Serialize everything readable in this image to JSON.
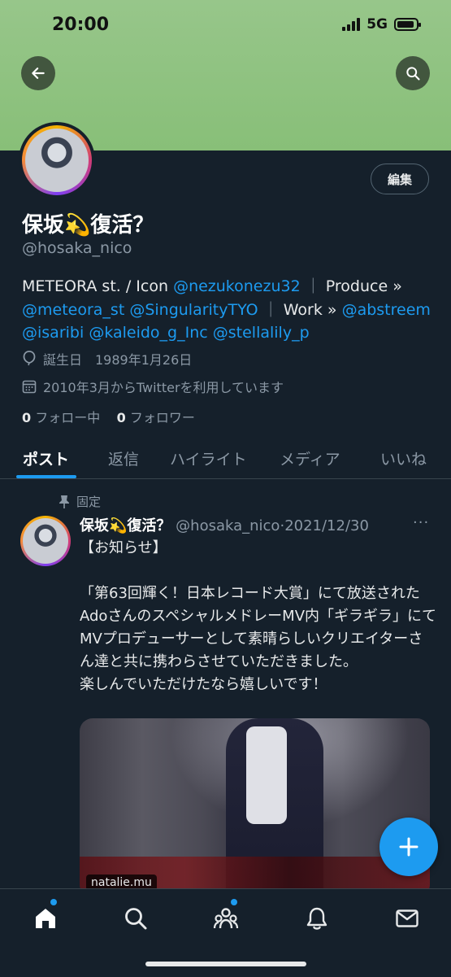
{
  "status": {
    "time": "20:00",
    "network": "5G"
  },
  "profile": {
    "display_name": "保坂💫復活？",
    "handle": "@hosaka_nico",
    "edit_label": "編集",
    "bio": {
      "part1": "METEORA st. / Icon ",
      "mention1": "@nezukonezu32",
      "sep1": " ｜ ",
      "part2": "Produce » ",
      "mention2": "@meteora_st",
      "mention3": "@SingularityTYO",
      "sep2": " ｜ ",
      "part3": "Work » ",
      "mention4": "@abstreem",
      "mention5": "@isaribi",
      "mention6": "@kaleido_g_Inc",
      "mention7": "@stellalily_p"
    },
    "birthday": "誕生日　1989年1月26日",
    "joined": "2010年3月からTwitterを利用しています",
    "following_count": "0",
    "following_label": "フォロー中",
    "followers_count": "0",
    "followers_label": "フォロワー"
  },
  "tabs": [
    "ポスト",
    "返信",
    "ハイライト",
    "メディア",
    "いいね"
  ],
  "post": {
    "pinned_label": "固定",
    "name": "保坂💫復活？",
    "handle": "@hosaka_nico",
    "date": "2021/12/30",
    "more": "···",
    "text": "【お知らせ】\n\n「第63回輝く！日本レコード大賞」にて放送されたAdoさんのスペシャルメドレーMV内「ギラギラ」にてMVプロデューサーとして素晴らしいクリエイターさん達と共に携わらさせていただきました。\n楽しんでいただけたなら嬉しいです！",
    "media_source": "natalie.mu"
  },
  "icons": {
    "back": "arrow-left-icon",
    "search": "search-icon",
    "birthday": "balloon-icon",
    "calendar": "calendar-icon",
    "pin": "pin-icon",
    "compose": "plus-icon",
    "nav": [
      "home-icon",
      "search-icon",
      "communities-icon",
      "bell-icon",
      "mail-icon"
    ]
  },
  "colors": {
    "accent": "#1d9bf0",
    "background": "#15202b",
    "banner": "#93c584"
  }
}
